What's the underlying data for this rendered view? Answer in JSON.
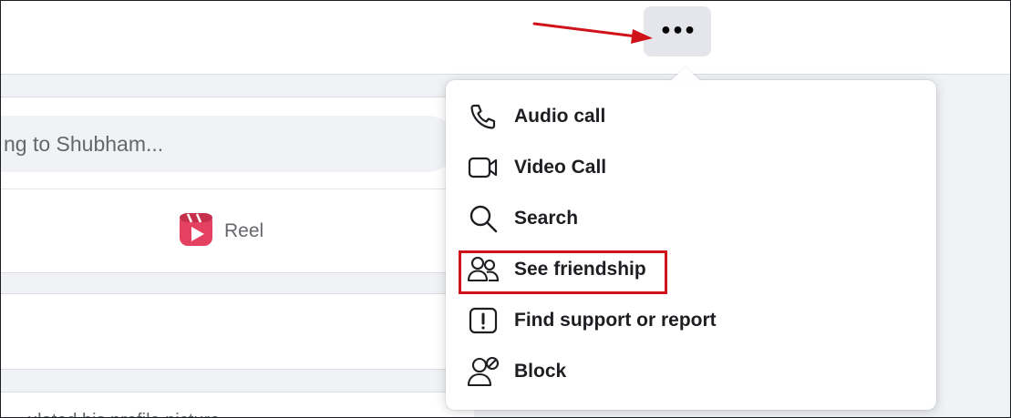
{
  "header": {
    "more_button_label": "•••",
    "annotation_color": "#d0121b"
  },
  "composer": {
    "placeholder": "ng to Shubham...",
    "reel_label": "Reel",
    "reel_icon": "reel-icon",
    "reel_color": "#e4405f"
  },
  "feed": {
    "partial_text": "ulated his profile picture"
  },
  "menu": {
    "items": [
      {
        "label": "Audio call",
        "icon": "phone-icon"
      },
      {
        "label": "Video Call",
        "icon": "video-camera-icon"
      },
      {
        "label": "Search",
        "icon": "search-icon"
      },
      {
        "label": "See friendship",
        "icon": "friends-icon",
        "highlighted": true
      },
      {
        "label": "Find support or report",
        "icon": "report-icon"
      },
      {
        "label": "Block",
        "icon": "block-user-icon"
      }
    ]
  }
}
